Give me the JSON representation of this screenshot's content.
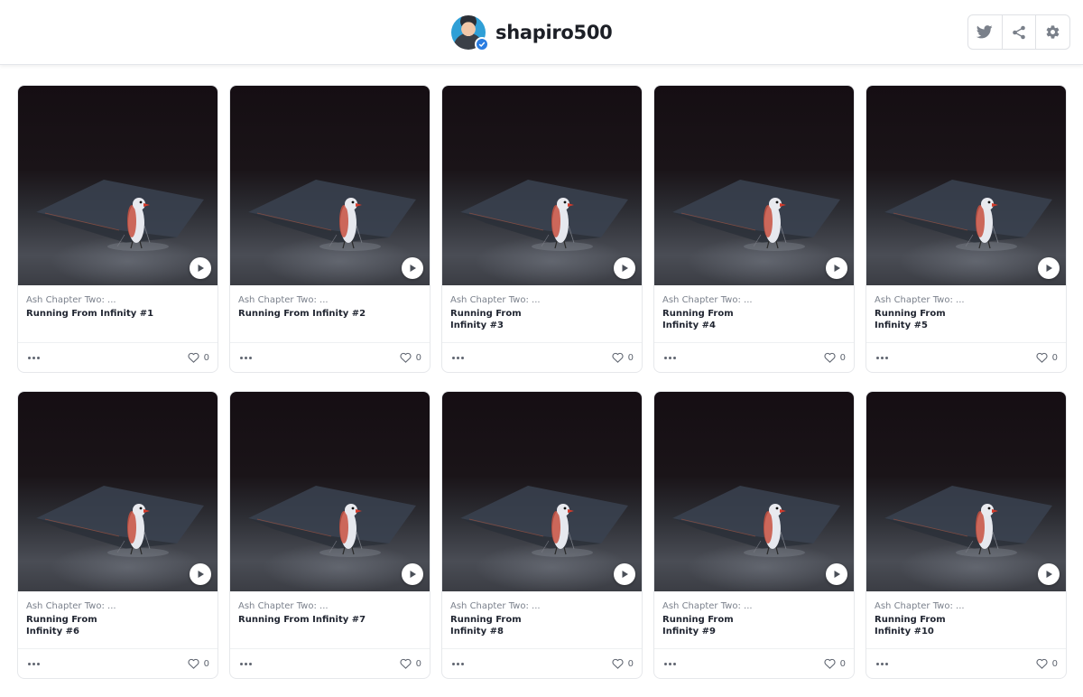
{
  "header": {
    "username": "shapiro500",
    "avatar_icon": "avatar",
    "verified_icon": "verified-badge-icon",
    "actions": [
      {
        "name": "twitter-button",
        "icon": "twitter-icon"
      },
      {
        "name": "share-button",
        "icon": "share-icon"
      },
      {
        "name": "settings-button",
        "icon": "gear-icon"
      }
    ]
  },
  "colors": {
    "verified": "#2a7de1",
    "icon_gray": "#7a808a",
    "thumbnail_dark": "#150e13"
  },
  "cards": [
    {
      "collection": "Ash Chapter Two: ...",
      "title": "Running From Infinity #1",
      "likes": "0"
    },
    {
      "collection": "Ash Chapter Two: ...",
      "title": "Running From Infinity #2",
      "likes": "0"
    },
    {
      "collection": "Ash Chapter Two: ...",
      "title": "Running From Infinity #3",
      "likes": "0"
    },
    {
      "collection": "Ash Chapter Two: ...",
      "title": "Running From Infinity #4",
      "likes": "0"
    },
    {
      "collection": "Ash Chapter Two: ...",
      "title": "Running From Infinity #5",
      "likes": "0"
    },
    {
      "collection": "Ash Chapter Two: ...",
      "title": "Running From Infinity #6",
      "likes": "0"
    },
    {
      "collection": "Ash Chapter Two: ...",
      "title": "Running From Infinity #7",
      "likes": "0"
    },
    {
      "collection": "Ash Chapter Two: ...",
      "title": "Running From Infinity #8",
      "likes": "0"
    },
    {
      "collection": "Ash Chapter Two: ...",
      "title": "Running From Infinity #9",
      "likes": "0"
    },
    {
      "collection": "Ash Chapter Two: ...",
      "title": "Running From Infinity #10",
      "likes": "0"
    }
  ]
}
